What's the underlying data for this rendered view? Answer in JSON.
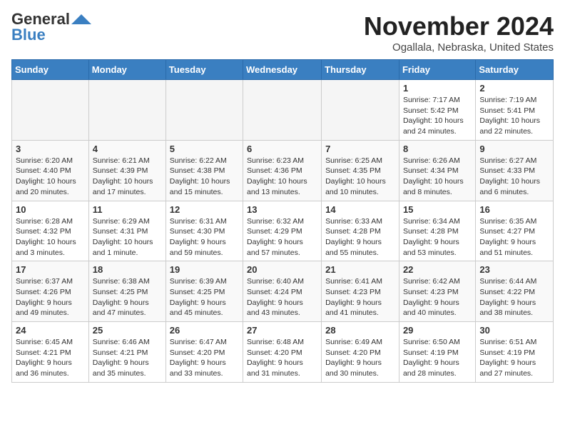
{
  "header": {
    "logo_general": "General",
    "logo_blue": "Blue",
    "month": "November 2024",
    "location": "Ogallala, Nebraska, United States"
  },
  "days_of_week": [
    "Sunday",
    "Monday",
    "Tuesday",
    "Wednesday",
    "Thursday",
    "Friday",
    "Saturday"
  ],
  "weeks": [
    [
      {
        "day": "",
        "info": ""
      },
      {
        "day": "",
        "info": ""
      },
      {
        "day": "",
        "info": ""
      },
      {
        "day": "",
        "info": ""
      },
      {
        "day": "",
        "info": ""
      },
      {
        "day": "1",
        "info": "Sunrise: 7:17 AM\nSunset: 5:42 PM\nDaylight: 10 hours and 24 minutes."
      },
      {
        "day": "2",
        "info": "Sunrise: 7:19 AM\nSunset: 5:41 PM\nDaylight: 10 hours and 22 minutes."
      }
    ],
    [
      {
        "day": "3",
        "info": "Sunrise: 6:20 AM\nSunset: 4:40 PM\nDaylight: 10 hours and 20 minutes."
      },
      {
        "day": "4",
        "info": "Sunrise: 6:21 AM\nSunset: 4:39 PM\nDaylight: 10 hours and 17 minutes."
      },
      {
        "day": "5",
        "info": "Sunrise: 6:22 AM\nSunset: 4:38 PM\nDaylight: 10 hours and 15 minutes."
      },
      {
        "day": "6",
        "info": "Sunrise: 6:23 AM\nSunset: 4:36 PM\nDaylight: 10 hours and 13 minutes."
      },
      {
        "day": "7",
        "info": "Sunrise: 6:25 AM\nSunset: 4:35 PM\nDaylight: 10 hours and 10 minutes."
      },
      {
        "day": "8",
        "info": "Sunrise: 6:26 AM\nSunset: 4:34 PM\nDaylight: 10 hours and 8 minutes."
      },
      {
        "day": "9",
        "info": "Sunrise: 6:27 AM\nSunset: 4:33 PM\nDaylight: 10 hours and 6 minutes."
      }
    ],
    [
      {
        "day": "10",
        "info": "Sunrise: 6:28 AM\nSunset: 4:32 PM\nDaylight: 10 hours and 3 minutes."
      },
      {
        "day": "11",
        "info": "Sunrise: 6:29 AM\nSunset: 4:31 PM\nDaylight: 10 hours and 1 minute."
      },
      {
        "day": "12",
        "info": "Sunrise: 6:31 AM\nSunset: 4:30 PM\nDaylight: 9 hours and 59 minutes."
      },
      {
        "day": "13",
        "info": "Sunrise: 6:32 AM\nSunset: 4:29 PM\nDaylight: 9 hours and 57 minutes."
      },
      {
        "day": "14",
        "info": "Sunrise: 6:33 AM\nSunset: 4:28 PM\nDaylight: 9 hours and 55 minutes."
      },
      {
        "day": "15",
        "info": "Sunrise: 6:34 AM\nSunset: 4:28 PM\nDaylight: 9 hours and 53 minutes."
      },
      {
        "day": "16",
        "info": "Sunrise: 6:35 AM\nSunset: 4:27 PM\nDaylight: 9 hours and 51 minutes."
      }
    ],
    [
      {
        "day": "17",
        "info": "Sunrise: 6:37 AM\nSunset: 4:26 PM\nDaylight: 9 hours and 49 minutes."
      },
      {
        "day": "18",
        "info": "Sunrise: 6:38 AM\nSunset: 4:25 PM\nDaylight: 9 hours and 47 minutes."
      },
      {
        "day": "19",
        "info": "Sunrise: 6:39 AM\nSunset: 4:25 PM\nDaylight: 9 hours and 45 minutes."
      },
      {
        "day": "20",
        "info": "Sunrise: 6:40 AM\nSunset: 4:24 PM\nDaylight: 9 hours and 43 minutes."
      },
      {
        "day": "21",
        "info": "Sunrise: 6:41 AM\nSunset: 4:23 PM\nDaylight: 9 hours and 41 minutes."
      },
      {
        "day": "22",
        "info": "Sunrise: 6:42 AM\nSunset: 4:23 PM\nDaylight: 9 hours and 40 minutes."
      },
      {
        "day": "23",
        "info": "Sunrise: 6:44 AM\nSunset: 4:22 PM\nDaylight: 9 hours and 38 minutes."
      }
    ],
    [
      {
        "day": "24",
        "info": "Sunrise: 6:45 AM\nSunset: 4:21 PM\nDaylight: 9 hours and 36 minutes."
      },
      {
        "day": "25",
        "info": "Sunrise: 6:46 AM\nSunset: 4:21 PM\nDaylight: 9 hours and 35 minutes."
      },
      {
        "day": "26",
        "info": "Sunrise: 6:47 AM\nSunset: 4:20 PM\nDaylight: 9 hours and 33 minutes."
      },
      {
        "day": "27",
        "info": "Sunrise: 6:48 AM\nSunset: 4:20 PM\nDaylight: 9 hours and 31 minutes."
      },
      {
        "day": "28",
        "info": "Sunrise: 6:49 AM\nSunset: 4:20 PM\nDaylight: 9 hours and 30 minutes."
      },
      {
        "day": "29",
        "info": "Sunrise: 6:50 AM\nSunset: 4:19 PM\nDaylight: 9 hours and 28 minutes."
      },
      {
        "day": "30",
        "info": "Sunrise: 6:51 AM\nSunset: 4:19 PM\nDaylight: 9 hours and 27 minutes."
      }
    ]
  ]
}
